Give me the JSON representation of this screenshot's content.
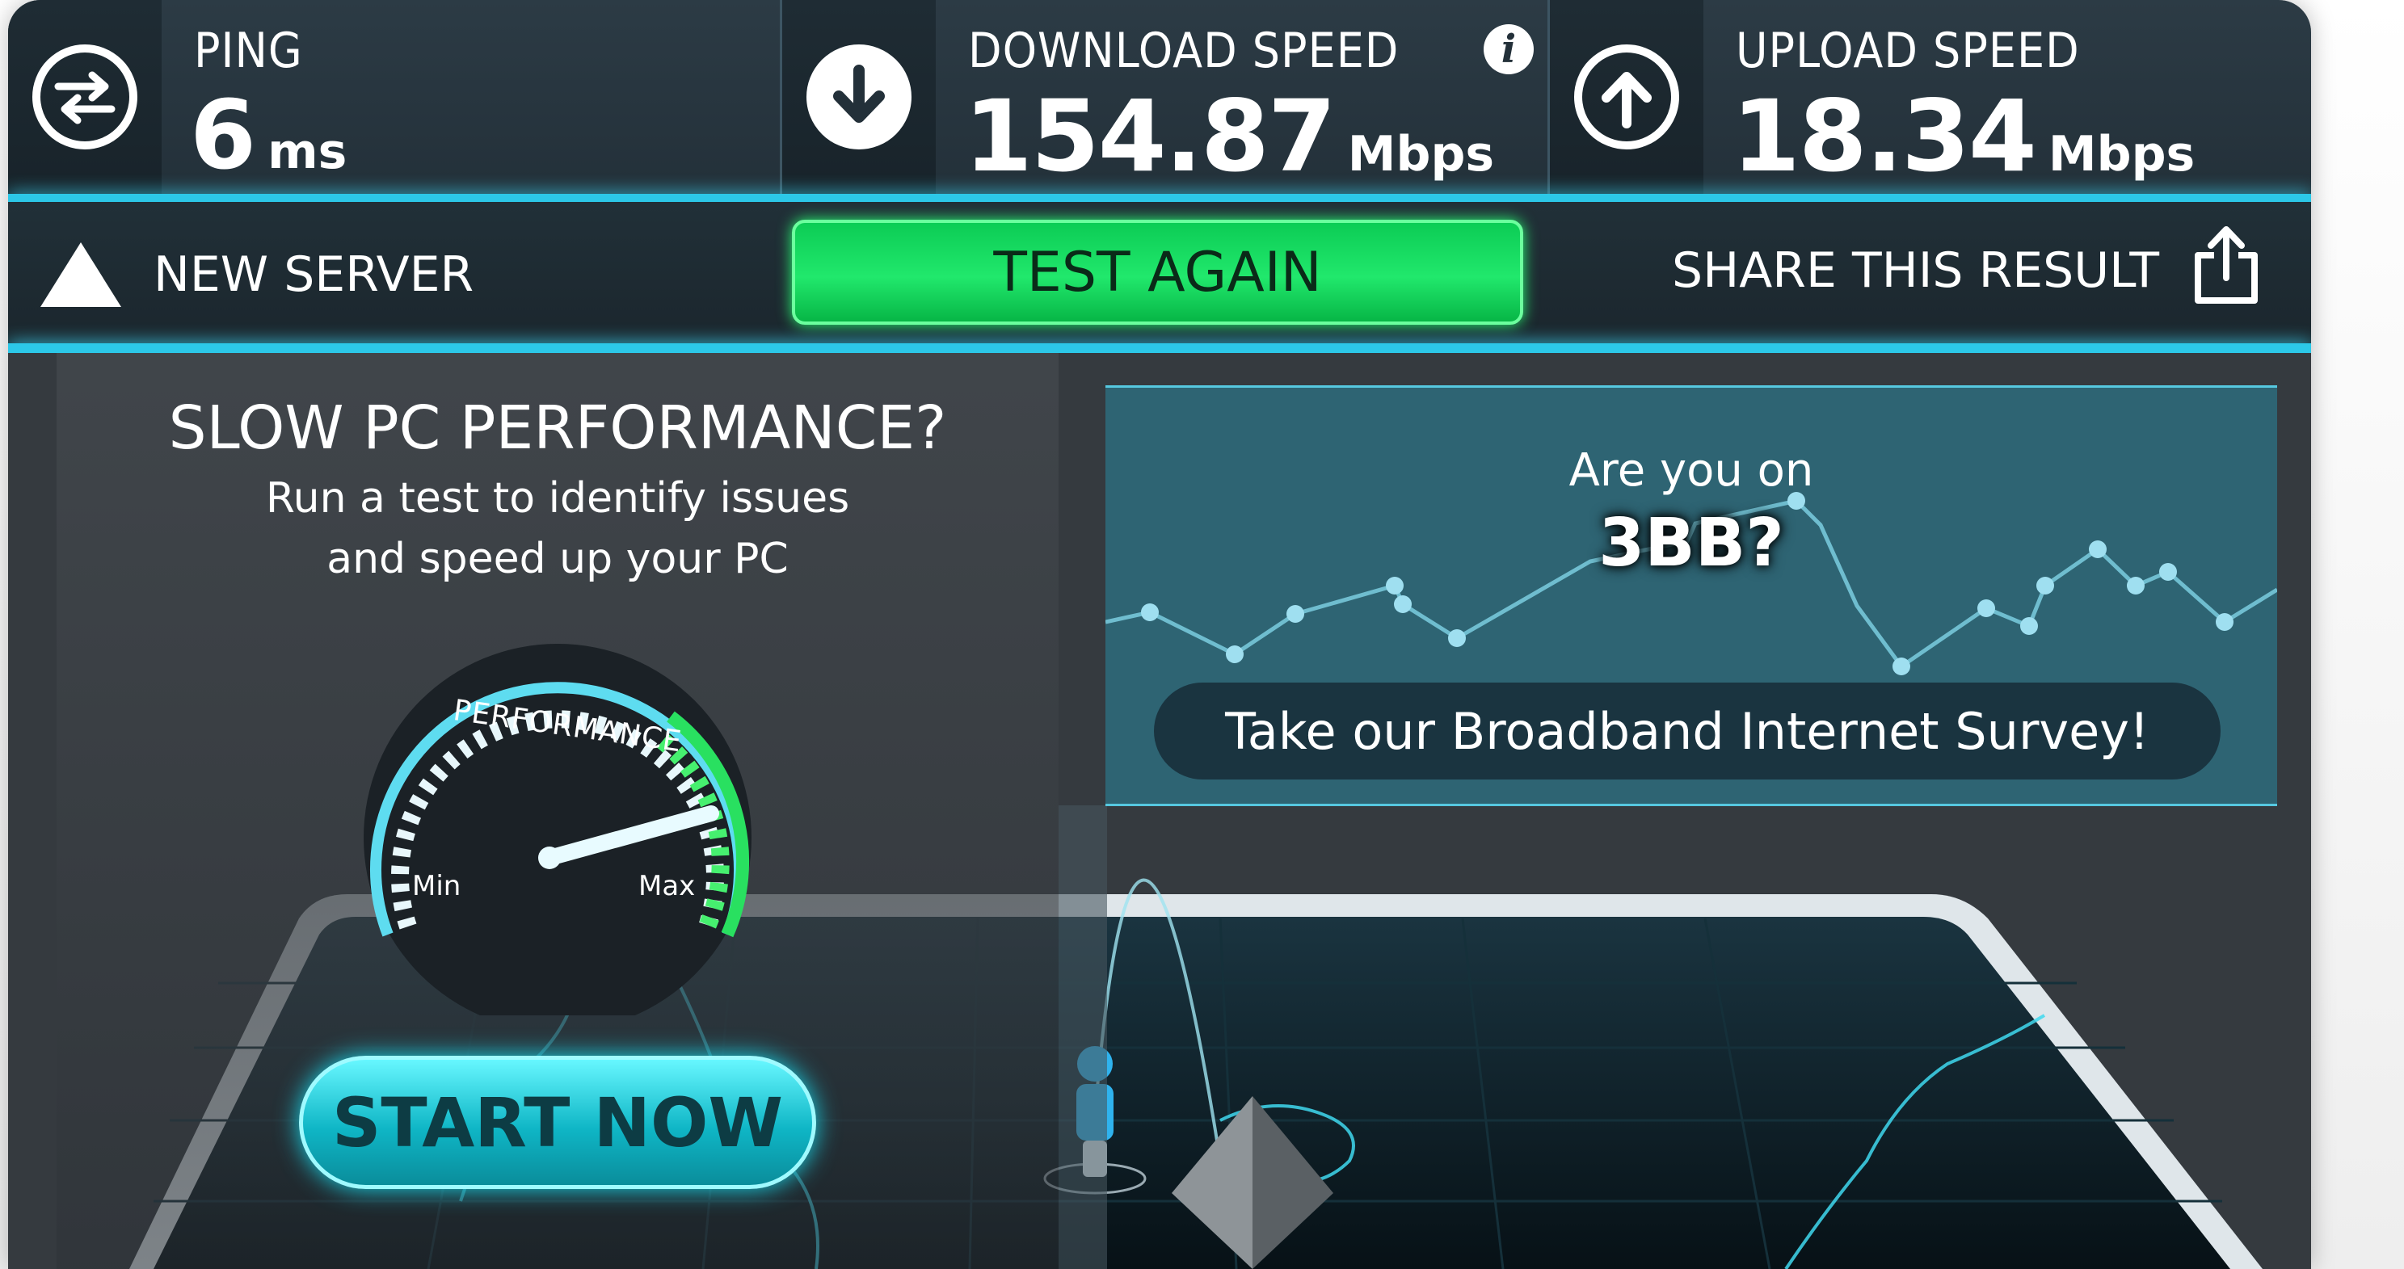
{
  "header": {
    "ping": {
      "label": "PING",
      "value": "6",
      "unit": "ms",
      "icon": "swap-arrows-icon"
    },
    "download": {
      "label": "DOWNLOAD SPEED",
      "value": "154.87",
      "unit": "Mbps",
      "icon": "download-arrow-icon",
      "info_icon": "info-icon"
    },
    "upload": {
      "label": "UPLOAD SPEED",
      "value": "18.34",
      "unit": "Mbps",
      "icon": "upload-arrow-icon"
    }
  },
  "actions": {
    "new_server": "NEW SERVER",
    "test_again": "TEST AGAIN",
    "share": "SHARE THIS RESULT"
  },
  "ad": {
    "title": "SLOW PC PERFORMANCE?",
    "subtitle_line1": "Run a test to identify issues",
    "subtitle_line2": "and speed up your PC",
    "gauge_label": "PERFORMANCE",
    "gauge_min": "Min",
    "gauge_max": "Max",
    "cta": "START NOW"
  },
  "survey": {
    "question": "Are you on",
    "isp": "3BB?",
    "cta": "Take our Broadband Internet Survey!"
  },
  "colors": {
    "accent_cyan": "#2cc8e8",
    "button_green": "#21e86c",
    "panel_dark": "#1b262d"
  }
}
